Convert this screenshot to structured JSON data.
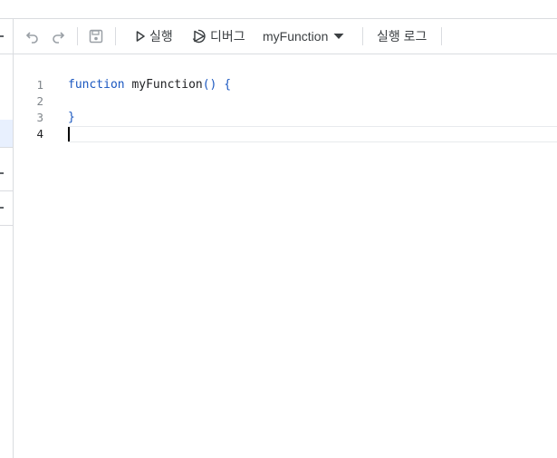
{
  "toolbar": {
    "undo_icon": "undo-icon",
    "redo_icon": "redo-icon",
    "save_icon": "save-icon",
    "run_icon": "play-icon",
    "run_label": "실행",
    "debug_icon": "debug-icon",
    "debug_label": "디버그",
    "function_select": "myFunction",
    "dropdown_icon": "caret-down-icon",
    "log_label": "실행 로그"
  },
  "editor": {
    "lines": [
      {
        "num": "1",
        "keyword": "function",
        "name": "myFunction",
        "punct": "() {"
      },
      {
        "num": "2"
      },
      {
        "num": "3",
        "punct": "}"
      },
      {
        "num": "4"
      }
    ],
    "active_line": 4
  },
  "colors": {
    "keyword": "#1a57c0",
    "border": "#dadce0",
    "active_row": "#e8f0fe"
  }
}
